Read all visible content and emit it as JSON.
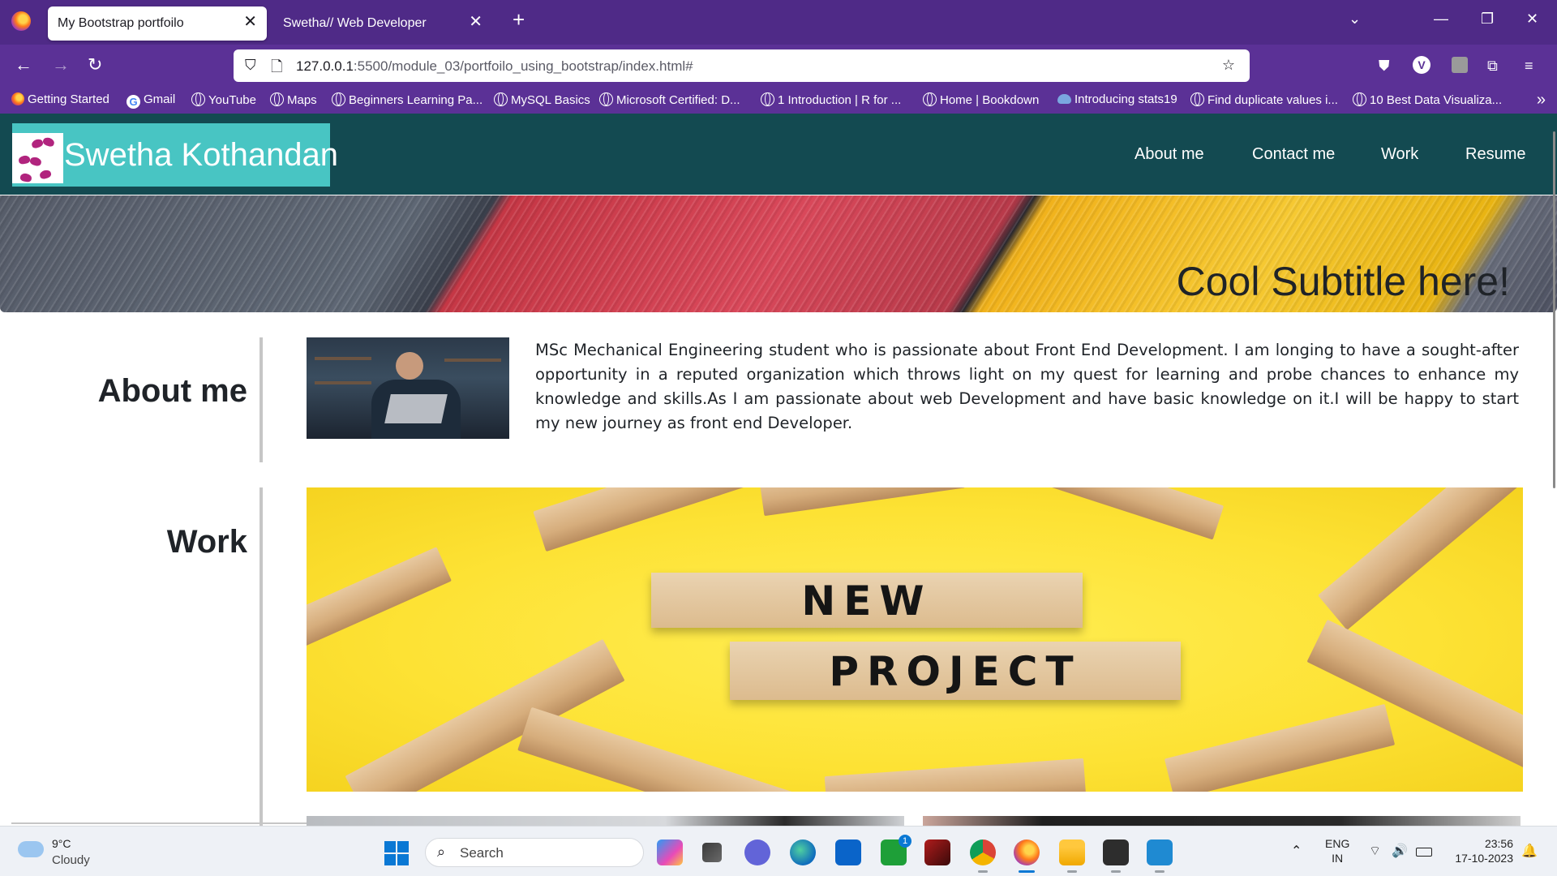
{
  "browser": {
    "tabs": [
      {
        "title": "My Bootstrap portfoilo",
        "active": true
      },
      {
        "title": "Swetha// Web Developer",
        "active": false
      }
    ],
    "url_host": "127.0.0.1",
    "url_path": ":5500/module_03/portfoilo_using_bootstrap/index.html#",
    "bookmarks": [
      "Getting Started",
      "Gmail",
      "YouTube",
      "Maps",
      "Beginners Learning Pa...",
      "MySQL Basics",
      "Microsoft Certified: D...",
      "1 Introduction | R for ...",
      "Home | Bookdown",
      "Introducing stats19",
      "Find duplicate values i...",
      "10 Best Data Visualiza..."
    ],
    "profile_initial": "V"
  },
  "site": {
    "brand": "Swetha Kothandan",
    "nav": [
      "About me",
      "Contact me",
      "Work",
      "Resume"
    ],
    "hero_subtitle": "Cool Subtitle here!",
    "about": {
      "title": "About me",
      "text": "MSc Mechanical Engineering student who is passionate about Front End Development. I am longing to have a sought-after opportunity in a reputed organization which throws light on my quest for learning and probe chances to enhance my knowledge and skills.As I am passionate about web Development and have basic knowledge on it.I will be happy to start my new journey as front end Developer."
    },
    "work": {
      "title": "Work",
      "image_words": [
        "NEW",
        "PROJECT"
      ]
    }
  },
  "taskbar": {
    "weather_temp": "9°C",
    "weather_desc": "Cloudy",
    "search_label": "Search",
    "lang_line1": "ENG",
    "lang_line2": "IN",
    "time": "23:56",
    "date": "17-10-2023",
    "teams_badge": "1"
  },
  "colors": {
    "tabbar": "#4f2a87",
    "toolbar": "#5b3196",
    "site_nav": "#134a51",
    "brand_bg": "#48c5c3",
    "work_bg": "#fde234"
  }
}
